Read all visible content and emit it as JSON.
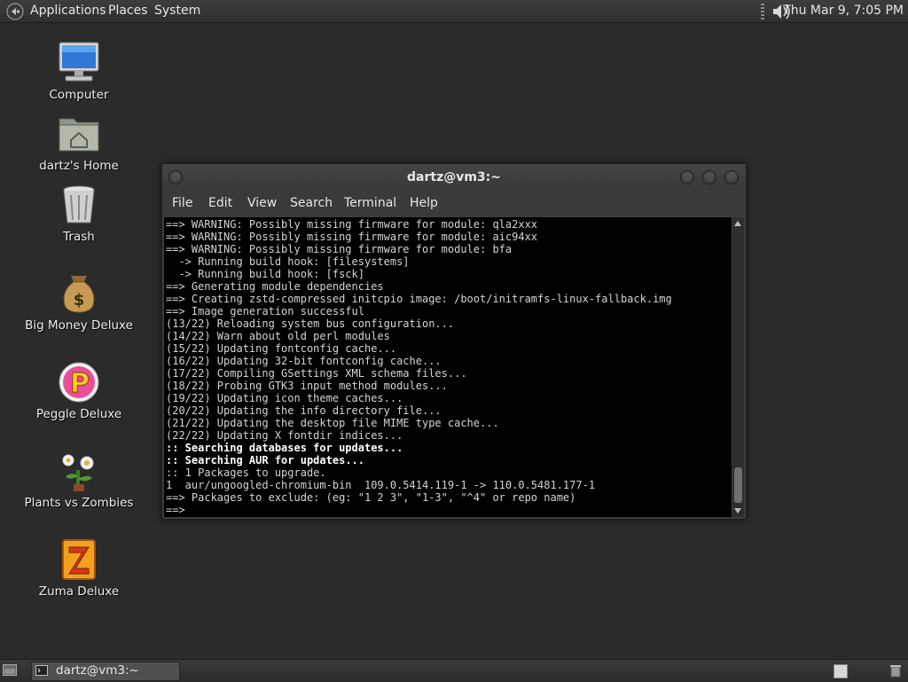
{
  "top_panel": {
    "menus": [
      "Applications",
      "Places",
      "System"
    ],
    "clock": "Thu Mar  9,  7:05 PM"
  },
  "desktop_icons": [
    {
      "label": "Computer",
      "icon": "computer-icon"
    },
    {
      "label": "dartz's Home",
      "icon": "home-folder-icon"
    },
    {
      "label": "Trash",
      "icon": "trash-icon"
    },
    {
      "label": "Big Money Deluxe",
      "icon": "money-bag-icon"
    },
    {
      "label": "Peggle Deluxe",
      "icon": "peggle-icon"
    },
    {
      "label": "Plants vs Zombies",
      "icon": "plants-vs-zombies-icon"
    },
    {
      "label": "Zuma Deluxe",
      "icon": "zuma-icon"
    }
  ],
  "terminal": {
    "title": "dartz@vm3:~",
    "menus": [
      "File",
      "Edit",
      "View",
      "Search",
      "Terminal",
      "Help"
    ],
    "lines": [
      {
        "text": "==> WARNING: Possibly missing firmware for module: qla2xxx",
        "bold": false
      },
      {
        "text": "==> WARNING: Possibly missing firmware for module: aic94xx",
        "bold": false
      },
      {
        "text": "==> WARNING: Possibly missing firmware for module: bfa",
        "bold": false
      },
      {
        "text": "  -> Running build hook: [filesystems]",
        "bold": false
      },
      {
        "text": "  -> Running build hook: [fsck]",
        "bold": false
      },
      {
        "text": "==> Generating module dependencies",
        "bold": false
      },
      {
        "text": "==> Creating zstd-compressed initcpio image: /boot/initramfs-linux-fallback.img",
        "bold": false
      },
      {
        "text": "==> Image generation successful",
        "bold": false
      },
      {
        "text": "(13/22) Reloading system bus configuration...",
        "bold": false
      },
      {
        "text": "(14/22) Warn about old perl modules",
        "bold": false
      },
      {
        "text": "(15/22) Updating fontconfig cache...",
        "bold": false
      },
      {
        "text": "(16/22) Updating 32-bit fontconfig cache...",
        "bold": false
      },
      {
        "text": "(17/22) Compiling GSettings XML schema files...",
        "bold": false
      },
      {
        "text": "(18/22) Probing GTK3 input method modules...",
        "bold": false
      },
      {
        "text": "(19/22) Updating icon theme caches...",
        "bold": false
      },
      {
        "text": "(20/22) Updating the info directory file...",
        "bold": false
      },
      {
        "text": "(21/22) Updating the desktop file MIME type cache...",
        "bold": false
      },
      {
        "text": "(22/22) Updating X fontdir indices...",
        "bold": false
      },
      {
        "text": ":: Searching databases for updates...",
        "bold": true
      },
      {
        "text": ":: Searching AUR for updates...",
        "bold": true
      },
      {
        "text": ":: 1 Packages to upgrade.",
        "bold": false
      },
      {
        "text": "1  aur/ungoogled-chromium-bin  109.0.5414.119-1 -> 110.0.5481.177-1",
        "bold": false
      },
      {
        "text": "==> Packages to exclude: (eg: \"1 2 3\", \"1-3\", \"^4\" or repo name)",
        "bold": false
      },
      {
        "text": "==>",
        "bold": false
      }
    ]
  },
  "taskbar": {
    "window_button": "dartz@vm3:~"
  }
}
